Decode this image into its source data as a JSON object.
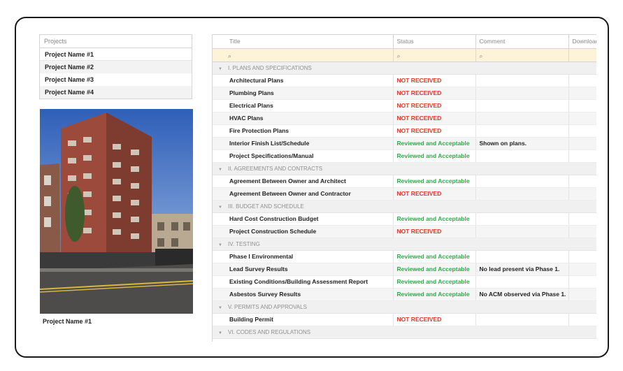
{
  "colors": {
    "not_received": "#d63a2f",
    "reviewed": "#2eaa4a",
    "filter_bg": "#fdf3d8",
    "group_bg": "#f0f0f0"
  },
  "projects": {
    "header": "Projects",
    "items": [
      "Project Name #1",
      "Project Name #2",
      "Project Name #3",
      "Project Name #4"
    ],
    "selected_index": 0,
    "caption": "Project Name #1"
  },
  "table": {
    "columns": [
      "Title",
      "Status",
      "Comment",
      "Download"
    ],
    "search_icon": "search-icon",
    "groups": [
      {
        "label": "I. PLANS AND SPECIFICATIONS",
        "rows": [
          {
            "title": "Architectural Plans",
            "status": "NOT RECEIVED",
            "comment": ""
          },
          {
            "title": "Plumbing Plans",
            "status": "NOT RECEIVED",
            "comment": ""
          },
          {
            "title": "Electrical Plans",
            "status": "NOT RECEIVED",
            "comment": ""
          },
          {
            "title": "HVAC Plans",
            "status": "NOT RECEIVED",
            "comment": ""
          },
          {
            "title": "Fire Protection Plans",
            "status": "NOT RECEIVED",
            "comment": ""
          },
          {
            "title": "Interior Finish List/Schedule",
            "status": "Reviewed and Acceptable",
            "comment": "Shown on plans."
          },
          {
            "title": "Project Specifications/Manual",
            "status": "Reviewed and Acceptable",
            "comment": ""
          }
        ]
      },
      {
        "label": "II. AGREEMENTS AND CONTRACTS",
        "rows": [
          {
            "title": "Agreement Between Owner and Architect",
            "status": "Reviewed and Acceptable",
            "comment": ""
          },
          {
            "title": "Agreement Between Owner and Contractor",
            "status": "NOT RECEIVED",
            "comment": ""
          }
        ]
      },
      {
        "label": "III. BUDGET AND SCHEDULE",
        "rows": [
          {
            "title": "Hard Cost Construction Budget",
            "status": "Reviewed and Acceptable",
            "comment": ""
          },
          {
            "title": "Project Construction Schedule",
            "status": "NOT RECEIVED",
            "comment": ""
          }
        ]
      },
      {
        "label": "IV. TESTING",
        "rows": [
          {
            "title": "Phase I Environmental",
            "status": "Reviewed and Acceptable",
            "comment": ""
          },
          {
            "title": "Lead Survey Results",
            "status": "Reviewed and Acceptable",
            "comment": "No lead present via Phase 1."
          },
          {
            "title": "Existing Conditions/Building Assessment Report",
            "status": "Reviewed and Acceptable",
            "comment": ""
          },
          {
            "title": "Asbestos Survey Results",
            "status": "Reviewed and Acceptable",
            "comment": "No ACM observed via Phase 1."
          }
        ]
      },
      {
        "label": "V. PERMITS AND APPROVALS",
        "rows": [
          {
            "title": "Building Permit",
            "status": "NOT RECEIVED",
            "comment": ""
          }
        ]
      },
      {
        "label": "VI. CODES AND REGULATIONS",
        "rows": []
      }
    ]
  }
}
